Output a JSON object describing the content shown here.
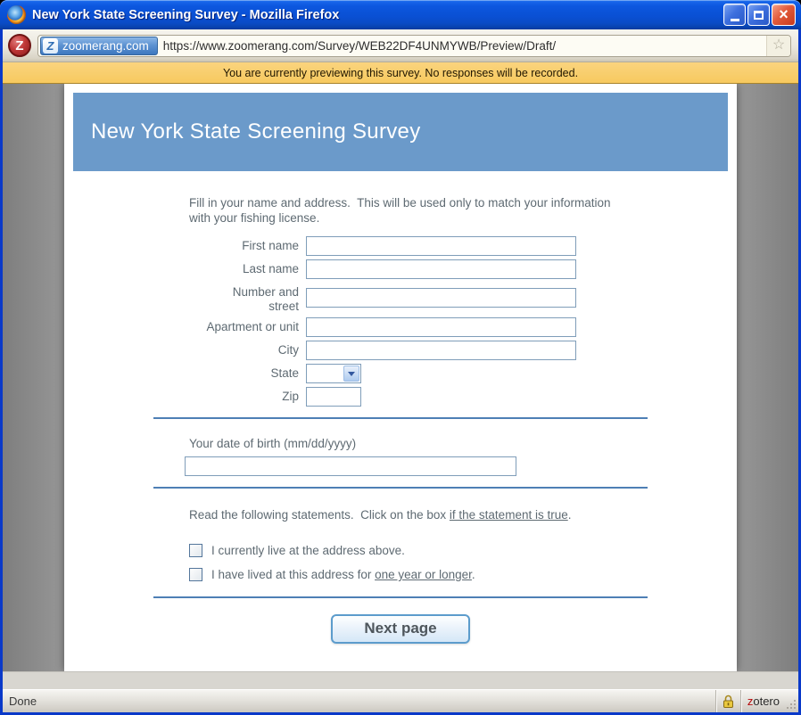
{
  "window": {
    "title": "New York State Screening Survey - Mozilla Firefox",
    "controls": {
      "minimize": "minimize",
      "maximize": "maximize",
      "close": "close"
    }
  },
  "address_bar": {
    "favicon_letter": "Z",
    "chip_letter": "Z",
    "site_label": "zoomerang.com",
    "url_rest": "https://www.zoomerang.com/Survey/WEB22DF4UNMYWB/Preview/Draft/",
    "star_icon": "☆"
  },
  "notification": {
    "text": "You are currently previewing this survey. No responses will be recorded."
  },
  "survey": {
    "title": "New York State Screening Survey",
    "header_color": "#6B9ACA",
    "intro": "Fill in your name and address.  This will be used only to match your information with your fishing license.",
    "fields": [
      {
        "label": "First name",
        "type": "text"
      },
      {
        "label": "Number and street",
        "type": "text"
      },
      {
        "label": "Last name",
        "type": "text"
      },
      {
        "label": "Apartment or unit",
        "type": "text"
      },
      {
        "label": "City",
        "type": "text"
      },
      {
        "label": "State",
        "type": "select"
      },
      {
        "label": "Zip",
        "type": "text-small"
      }
    ],
    "dob_label": "Your date of birth (mm/dd/yyyy)",
    "statements_intro": {
      "pre": "Read the following statements.  Click on the box ",
      "link": "if the statement is true",
      "post": "."
    },
    "statements": [
      {
        "text": "I currently live at the address above."
      },
      {
        "text_pre": "I have lived at this address for ",
        "link": "one year or longer",
        "text_post": "."
      }
    ],
    "next_button": "Next page",
    "divider_color": "#4E7FB5"
  },
  "status_bar": {
    "status": "Done",
    "zotero_z": "z",
    "zotero_rest": "otero"
  }
}
